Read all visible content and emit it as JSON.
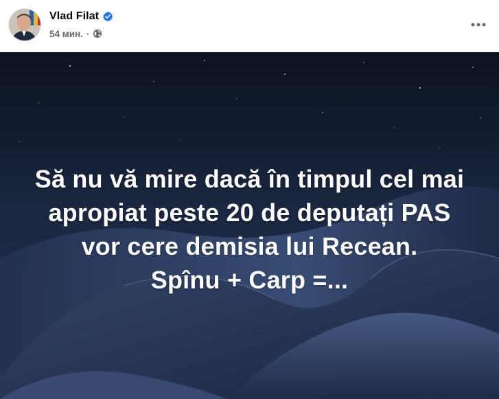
{
  "post": {
    "author_name": "Vlad Filat",
    "verified": true,
    "timestamp": "54 мин.",
    "separator": "·",
    "audience_icon": "globe-icon",
    "more_icon": "more-horizontal-icon",
    "text_lines": [
      "Să nu vă mire dacă în timpul cel mai",
      "apropiat peste 20 de deputați PAS",
      "vor cere demisia lui Recean.",
      "Spînu + Carp =..."
    ]
  },
  "colors": {
    "author_text": "#050505",
    "meta_text": "#65676b",
    "verified_badge": "#1877f2",
    "post_text": "#ffffff",
    "sky_top": "#0c1322",
    "sky_mid": "#1e2b44",
    "dune": "#2c3a58"
  }
}
